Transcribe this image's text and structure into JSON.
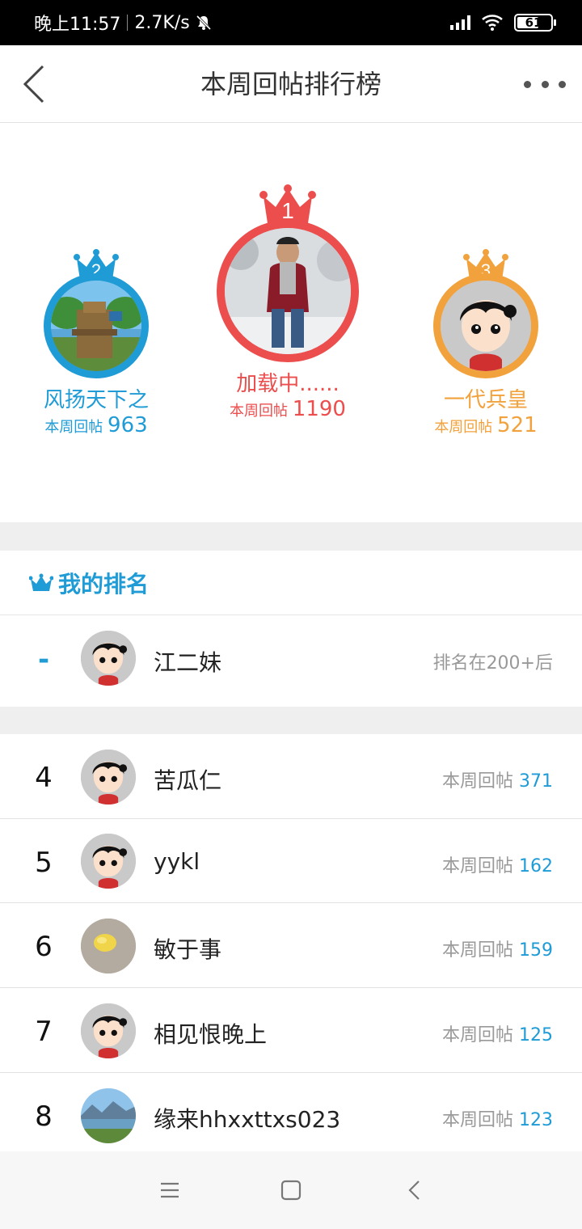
{
  "status_bar": {
    "time": "晚上11:57",
    "speed": "2.7K/s",
    "battery": "61"
  },
  "header": {
    "title": "本周回帖排行榜"
  },
  "podium": [
    {
      "rank": "1",
      "name": "加载中......",
      "stat_label": "本周回帖",
      "count": "1190",
      "color": "#ec4e4e"
    },
    {
      "rank": "2",
      "name": "风扬天下之",
      "stat_label": "本周回帖",
      "count": "963",
      "color": "#1f9bd6"
    },
    {
      "rank": "3",
      "name": "一代兵皇",
      "stat_label": "本周回帖",
      "count": "521",
      "color": "#f2a23c"
    }
  ],
  "my_rank": {
    "section_label": "我的排名",
    "rank": "-",
    "name": "江二妹",
    "status": "排名在200+后"
  },
  "list": [
    {
      "rank": "4",
      "name": "苦瓜仁",
      "stat_label": "本周回帖",
      "count": "371"
    },
    {
      "rank": "5",
      "name": "yykl",
      "stat_label": "本周回帖",
      "count": "162"
    },
    {
      "rank": "6",
      "name": "敏于事",
      "stat_label": "本周回帖",
      "count": "159"
    },
    {
      "rank": "7",
      "name": "相见恨晚上",
      "stat_label": "本周回帖",
      "count": "125"
    },
    {
      "rank": "8",
      "name": "缘来hhxxttxs023",
      "stat_label": "本周回帖",
      "count": "123"
    }
  ],
  "colors": {
    "accent_blue": "#1f9bd6",
    "first_red": "#ec4e4e",
    "third_orange": "#f2a23c"
  },
  "icons": {
    "back": "chevron-left-icon",
    "more": "more-dots-icon",
    "crown": "crown-icon"
  }
}
